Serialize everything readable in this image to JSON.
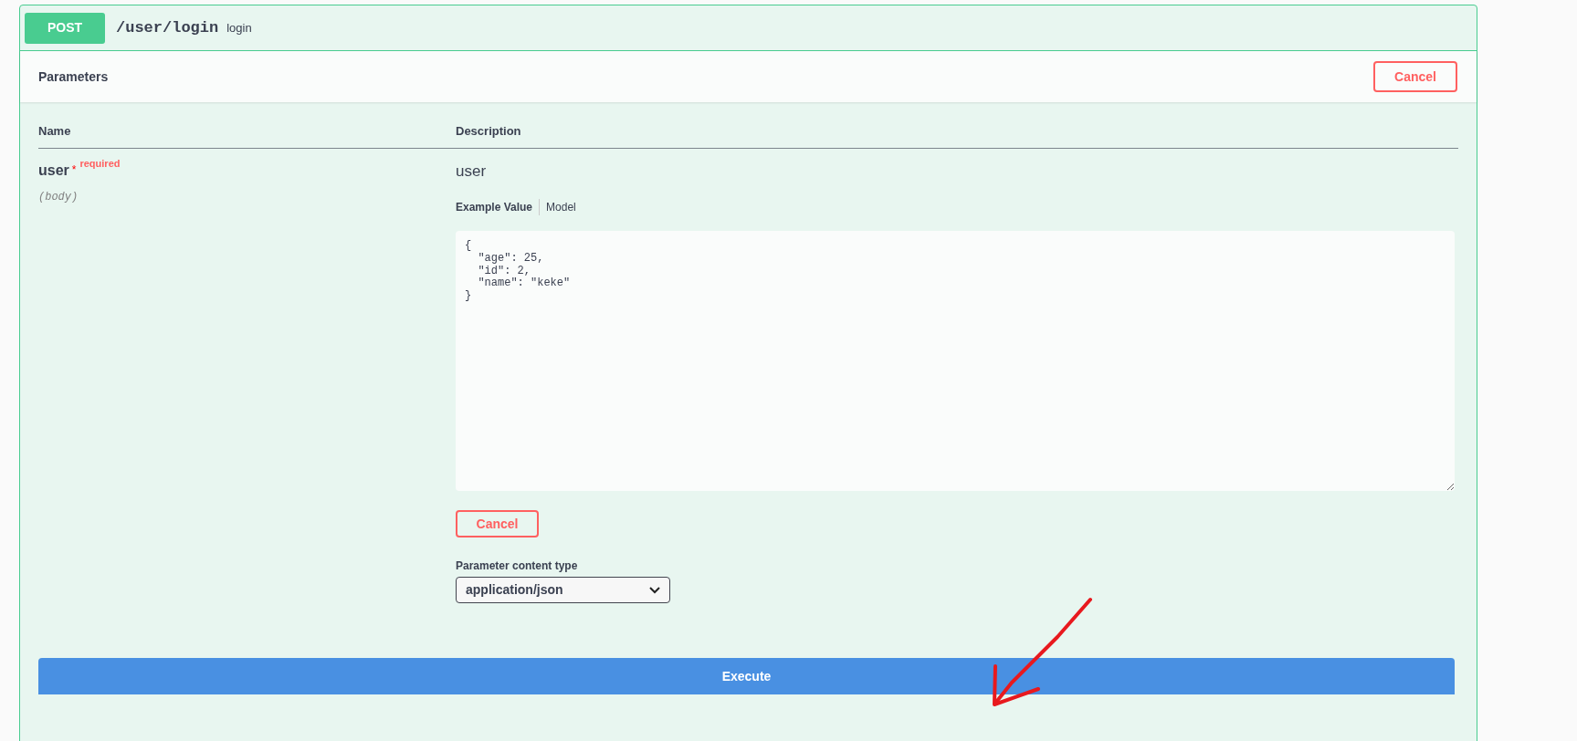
{
  "operation": {
    "method": "POST",
    "path": "/user/login",
    "summary": "login"
  },
  "parameters_header": {
    "title": "Parameters",
    "cancel": "Cancel"
  },
  "table": {
    "columns": [
      "Name",
      "Description"
    ]
  },
  "parameter": {
    "name": "user",
    "required_mark": "*",
    "required": "required",
    "location": "(body)",
    "description": "user",
    "tabs": [
      {
        "label": "Example Value",
        "selected": true
      },
      {
        "label": "Model",
        "selected": false
      }
    ],
    "body": "{\n  \"age\": 25,\n  \"id\": 2,\n  \"name\": \"keke\"\n}",
    "cancel": "Cancel",
    "content_type_label": "Parameter content type",
    "content_type": "application/json"
  },
  "execute": "Execute"
}
